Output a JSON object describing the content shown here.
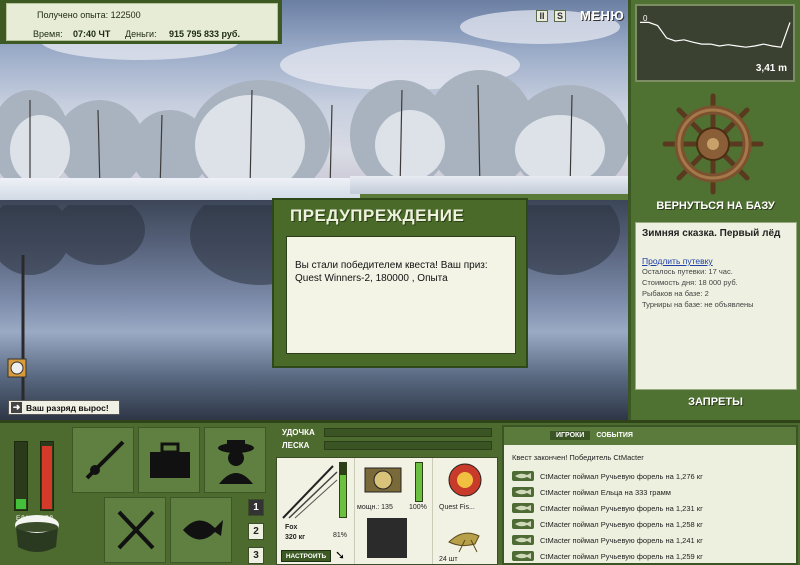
{
  "info": {
    "xp_label": "Получено опыта: 122500",
    "time_label": "Время:",
    "time_value": "07:40 ЧТ",
    "money_label": "Деньги:",
    "money_value": "915 795 833 руб."
  },
  "topbar": {
    "pause_icon": "II",
    "sound_icon": "S",
    "menu_label": "МЕНЮ"
  },
  "depth_chart": {
    "start_label": "0",
    "depth_value": "3,41 m",
    "profile": [
      0.2,
      0.2,
      0.25,
      0.45,
      0.5,
      0.48,
      0.52,
      0.55,
      0.55,
      0.58,
      0.56,
      0.58,
      0.6,
      0.58,
      0.55,
      0.58,
      0.6,
      0.2
    ]
  },
  "right_panel": {
    "return_label": "ВЕРНУТЬСЯ НА БАЗУ",
    "base_title": "Зимняя сказка. Первый лёд",
    "extend_link": "Продлить путевку",
    "lines": [
      "Осталось путевки: 17 час.",
      "Стоимость дня: 18 000 руб.",
      "Рыбаков на базе: 2",
      "Турниры на базе: не объявлены"
    ],
    "bans_label": "ЗАПРЕТЫ"
  },
  "dialog": {
    "title": "ПРЕДУПРЕЖДЕНИЕ",
    "message": "Вы стали победителем квеста! Ваш приз: Quest Winners-2, 180000 , Опыта"
  },
  "rank_message": "Ваш разряд вырос!",
  "meters": {
    "food_label": "ЕДА",
    "poison_label": "ЯД",
    "food_level": 0.15,
    "poison_level": 0.95
  },
  "slot_pages": [
    "1",
    "2",
    "3"
  ],
  "gear": {
    "rod_label": "УДОЧКА",
    "line_label": "ЛЕСКА",
    "rod_name": "Fox",
    "rod_weight": "320 кг",
    "rod_percent": "81%",
    "reel_power": "мощн.: 135",
    "reel_percent": "100%",
    "line_name": "Quest Fis...",
    "bait_count": "24 шт",
    "setup_button": "НАСТРОИТЬ"
  },
  "events": {
    "tab_players": "ИГРОКИ",
    "tab_events": "СОБЫТИЯ",
    "quest_done": "Квест закончен! Победитель CtMacter",
    "items": [
      "CtMacter поймал Ручьевую форель на 1,276 кг",
      "CtMacter поймал Ельца на 333 грамм",
      "CtMacter поймал Ручьевую форель на 1,231 кг",
      "CtMacter поймал Ручьевую форель на 1,258 кг",
      "CtMacter поймал Ручьевую форель на 1,241 кг",
      "CtMacter поймал Ручьевую форель на 1,259 кг"
    ]
  },
  "colors": {
    "panel_green": "#4f7131",
    "dark_green": "#3b5424",
    "light_bg": "#eef0e1"
  }
}
